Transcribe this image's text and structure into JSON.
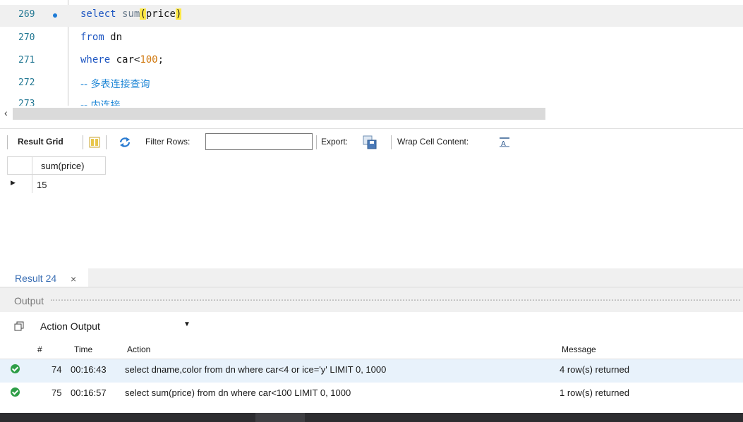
{
  "editor": {
    "lines": [
      {
        "no": "269",
        "has_dot": true
      },
      {
        "no": "270"
      },
      {
        "no": "271"
      },
      {
        "no": "272"
      },
      {
        "no": "273"
      }
    ],
    "line269": {
      "kw": "select",
      "fn": "sum",
      "open": "(",
      "arg": "price",
      "close": ")"
    },
    "line270": {
      "kw": "from",
      "rest": "dn"
    },
    "line271": {
      "kw": "where",
      "rest": "car<",
      "num": "100",
      "end": ";"
    },
    "line272": {
      "comment": "-- 多表连接查询"
    },
    "line273": {
      "comment": "-- 内连接"
    }
  },
  "result_toolbar": {
    "result_grid_label": "Result Grid",
    "filter_rows_label": "Filter Rows:",
    "filter_value": "",
    "export_label": "Export:",
    "wrap_label": "Wrap Cell Content:"
  },
  "grid": {
    "column": "sum(price)",
    "value": "15"
  },
  "result_tab": {
    "label": "Result 24",
    "close": "×"
  },
  "output": {
    "label": "Output",
    "dropdown_value": "Action Output",
    "headers": {
      "num": "#",
      "time": "Time",
      "action": "Action",
      "message": "Message"
    },
    "rows": [
      {
        "num": "74",
        "time": "00:16:43",
        "action": "select dname,color from dn where car<4 or ice='y' LIMIT 0, 1000",
        "message": "4 row(s) returned"
      },
      {
        "num": "75",
        "time": "00:16:57",
        "action": "select sum(price) from dn where car<100 LIMIT 0, 1000",
        "message": "1 row(s) returned"
      }
    ]
  },
  "colors": {
    "keyword": "#1f57c2",
    "number": "#d1780d",
    "comment": "#1f87d6",
    "success": "#2e9e47"
  }
}
